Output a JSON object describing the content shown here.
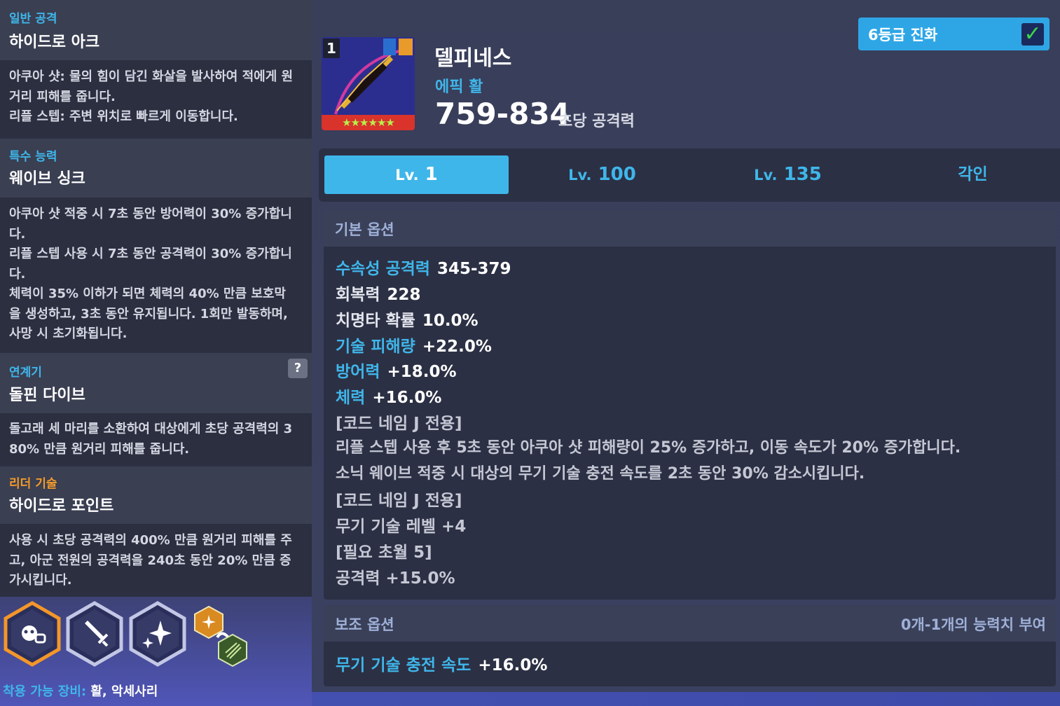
{
  "left": {
    "normal_attack": {
      "category": "일반 공격",
      "name": "하이드로 아크",
      "desc": [
        "아쿠아 샷: 물의 힘이 담긴 화살을 발사하여 적에게 원",
        "거리 피해를 줍니다.",
        "리플 스텝: 주변 위치로 빠르게 이동합니다."
      ]
    },
    "special": {
      "category": "특수 능력",
      "name": "웨이브 싱크",
      "desc": [
        "아쿠아 샷 적중 시 7초 동안 방어력이 30% 증가합니",
        "다.",
        "리플 스텝 사용 시 7초 동안 공격력이 30% 증가합니",
        "다.",
        "체력이 35% 이하가 되면 체력의 40% 만큼 보호막",
        "을 생성하고, 3초 동안 유지됩니다. 1회만 발동하며,",
        "사망 시 초기화됩니다."
      ]
    },
    "chain": {
      "category": "연계기",
      "name": "돌핀 다이브",
      "help": "?",
      "desc": [
        "돌고래 세 마리를 소환하여 대상에게 초당 공격력의 3",
        "80% 만큼 원거리 피해를 줍니다."
      ]
    },
    "leader": {
      "category": "리더 기술",
      "name": "하이드로 포인트",
      "desc": [
        "사용 시 초당 공격력의 400% 만큼 원거리 피해를 주",
        "고, 아군 전원의 공격력을 240초 동안 20% 만큼 증",
        "가시킵니다."
      ]
    },
    "icons": [
      "cat-paw-icon",
      "sword-icon",
      "sparkle-icon",
      "chain-link-icon"
    ],
    "equip_label": "착용 가능 장비:",
    "equip_value": "활, 악세사리"
  },
  "weapon": {
    "slot_level": "1",
    "stars": "★★★★★★",
    "name": "델피네스",
    "type": "에픽 활",
    "attack": "759-834",
    "attack_label": "초당 공격력"
  },
  "evolve": {
    "label": "6등급 진화",
    "checked": true
  },
  "tabs": [
    {
      "prefix": "Lv.",
      "value": "1",
      "active": true
    },
    {
      "prefix": "Lv.",
      "value": "100",
      "active": false
    },
    {
      "prefix": "Lv.",
      "value": "135",
      "active": false
    },
    {
      "prefix": "",
      "value": "각인",
      "active": false
    }
  ],
  "basic_options": {
    "title": "기본 옵션",
    "lines": [
      {
        "k": "수속성 공격력",
        "v": "345-379",
        "blue": true
      },
      {
        "k": "회복력",
        "v": "228",
        "blue": false
      },
      {
        "k": "치명타 확률",
        "v": "10.0%",
        "blue": false
      },
      {
        "k": "기술 피해량",
        "v": "+22.0%",
        "blue": true
      },
      {
        "k": "방어력",
        "v": "+18.0%",
        "blue": true
      },
      {
        "k": "체력",
        "v": "+16.0%",
        "blue": true
      },
      {
        "k": "[코드 네임 J 전용]",
        "v": "",
        "gray": true
      },
      {
        "k": "리플 스텝 사용 후 5초 동안 아쿠아 샷 피해량이 25% 증가하고, 이동 속도가 20% 증가합니다.",
        "v": "",
        "gray": true
      },
      {
        "k": "소닉 웨이브 적중 시 대상의 무기 기술 충전 속도를 2초 동안 30% 감소시킵니다.",
        "v": "",
        "gray": true
      },
      {
        "k": "[코드 네임 J 전용]",
        "v": "",
        "gray": true
      },
      {
        "k": "무기 기술 레벨 +4",
        "v": "",
        "gray": true
      },
      {
        "k": "[필요 초월 5]",
        "v": "",
        "gray": true
      },
      {
        "k": "공격력 +15.0%",
        "v": "",
        "gray": true
      }
    ]
  },
  "sub_options": {
    "title": "보조 옵션",
    "right": "0개-1개의 능력치 부여",
    "line": {
      "k": "무기 기술 충전 속도",
      "v": "+16.0%"
    }
  }
}
